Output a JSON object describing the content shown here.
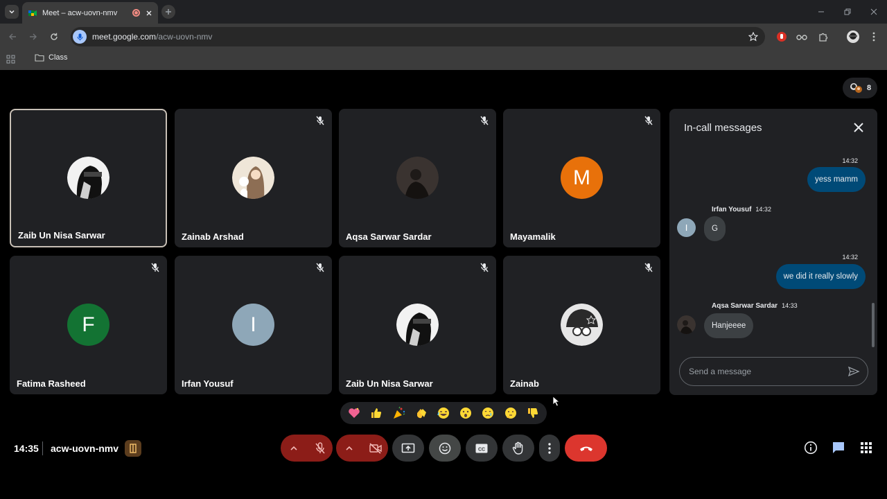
{
  "browser": {
    "tab_title": "Meet – acw-uovn-nmv",
    "url_host": "meet.google.com",
    "url_path": "/acw-uovn-nmv",
    "bookmark_folder": "Class"
  },
  "participants_count": "8",
  "tiles": [
    {
      "name": "Zaib Un Nisa Sarwar",
      "avatar": "photo",
      "muted": false,
      "active": true
    },
    {
      "name": "Zainab Arshad",
      "avatar": "photo",
      "muted": true
    },
    {
      "name": "Aqsa Sarwar Sardar",
      "avatar": "photo",
      "muted": true
    },
    {
      "name": "Mayamalik",
      "avatar_letter": "M",
      "avatar_color": "#e8710a",
      "muted": true
    },
    {
      "name": "Fatima Rasheed",
      "avatar_letter": "F",
      "avatar_color": "#137333",
      "muted": true
    },
    {
      "name": "Irfan Yousuf",
      "avatar_letter": "I",
      "avatar_color": "#8ea7b8",
      "muted": true
    },
    {
      "name": "Zaib Un Nisa Sarwar",
      "avatar": "photo",
      "muted": true
    },
    {
      "name": "Zainab",
      "avatar": "photo",
      "muted": true
    }
  ],
  "chat": {
    "title": "In-call messages",
    "messages": [
      {
        "direction": "out",
        "time": "14:32",
        "text": "yess mamm"
      },
      {
        "direction": "in",
        "sender": "Irfan Yousuf",
        "time": "14:32",
        "text": "G",
        "avatar_letter": "I"
      },
      {
        "direction": "out",
        "time": "14:32",
        "text": "we did it really slowly"
      },
      {
        "direction": "in",
        "sender": "Aqsa Sarwar Sardar",
        "time": "14:33",
        "text": "Hanjeeee"
      }
    ],
    "input_placeholder": "Send a message"
  },
  "reactions": [
    "💖",
    "👍",
    "🎉",
    "👏",
    "😂",
    "😮",
    "😢",
    "🤔",
    "👎"
  ],
  "meeting": {
    "time": "14:35",
    "code": "acw-uovn-nmv"
  },
  "colors": {
    "accent_blue": "#a8c7fa",
    "leave_red": "#dc362e",
    "muted_control_red": "#8c1d18",
    "out_bubble": "#004a77"
  }
}
